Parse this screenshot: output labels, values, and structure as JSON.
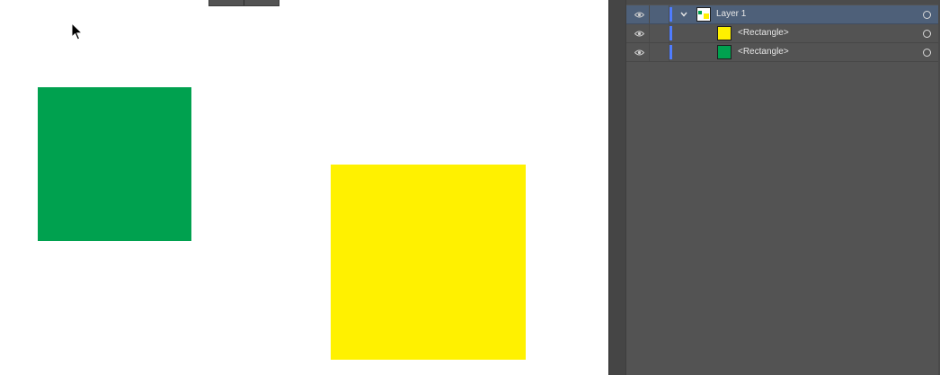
{
  "canvas": {
    "background": "#ffffff",
    "shapes": [
      {
        "name": "green-rectangle",
        "color": "#00a14f"
      },
      {
        "name": "yellow-rectangle",
        "color": "#fff100"
      }
    ]
  },
  "layers_panel": {
    "background": "#535353",
    "selected_row_color": "#4e6079",
    "layer_color": "#4f7cff",
    "layers": [
      {
        "label": "Layer 1",
        "selected": true,
        "expanded": true,
        "icons": [
          "eye-icon",
          "chevron-down-icon",
          "target-circle-icon"
        ]
      }
    ],
    "children": [
      {
        "label": "<Rectangle>",
        "swatch_color": "#fff100"
      },
      {
        "label": "<Rectangle>",
        "swatch_color": "#00a14f"
      }
    ]
  }
}
